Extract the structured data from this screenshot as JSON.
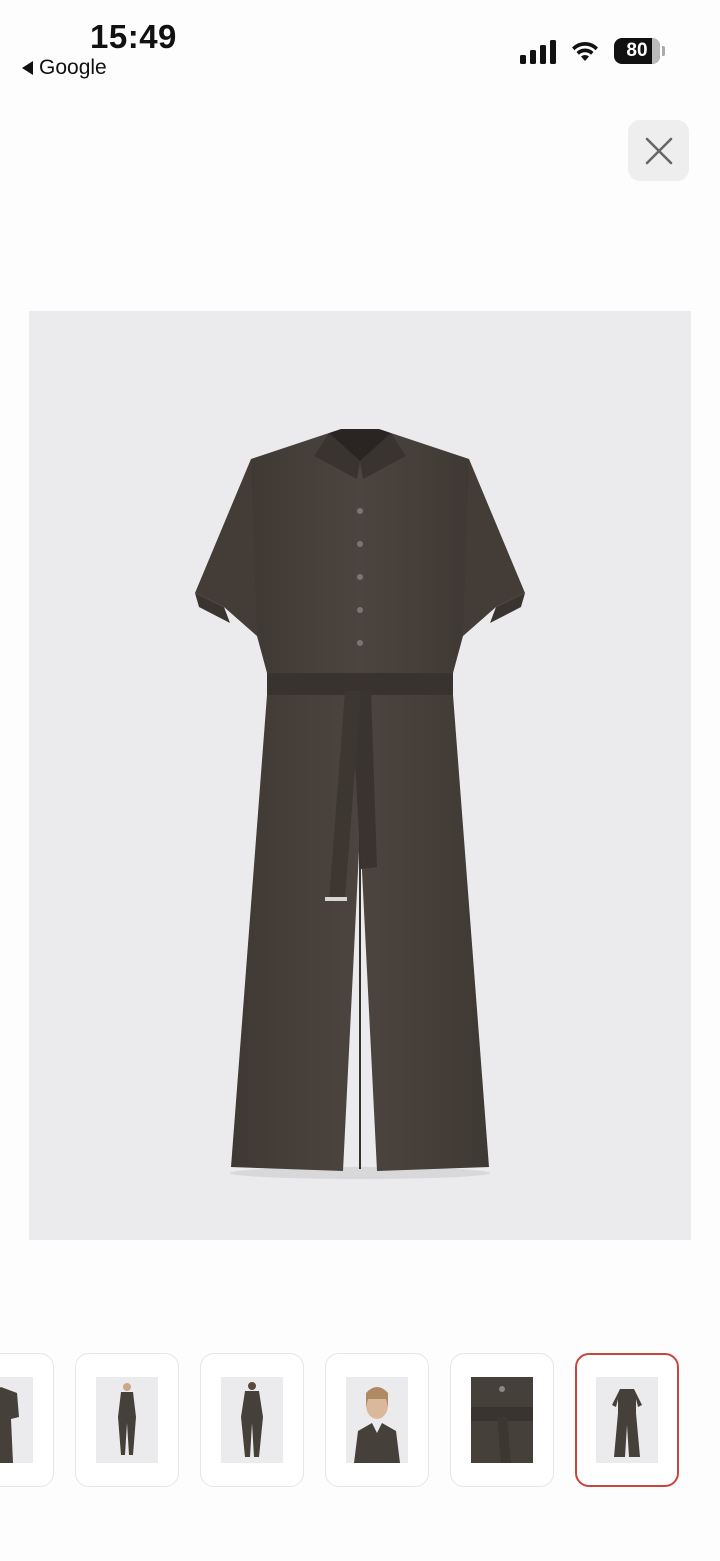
{
  "status_bar": {
    "time": "15:49",
    "back_app": "Google",
    "battery": "80",
    "icons": [
      "signal-icon",
      "wifi-icon",
      "battery-icon"
    ]
  },
  "close_button": {
    "icon": "close-icon"
  },
  "main_image": {
    "subject": "jumpsuit-photo",
    "garment_color": "#4a433d"
  },
  "thumbnails": {
    "count": 6,
    "selected_index": 5,
    "selected_border_color": "#c9463c"
  }
}
